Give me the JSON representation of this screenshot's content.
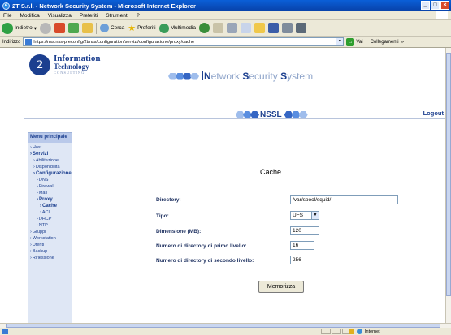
{
  "window": {
    "title": "2T S.r.l. - Network Security System - Microsoft Internet Explorer",
    "buttons": [
      "_",
      "□",
      "×"
    ]
  },
  "menubar": [
    "File",
    "Modifica",
    "Visualizza",
    "Preferiti",
    "Strumenti",
    "?"
  ],
  "toolbar": {
    "back": "Indietro",
    "search": "Cerca",
    "favorites": "Preferiti",
    "multimedia": "Multimedia"
  },
  "address": {
    "label": "Indirizzo",
    "url": "https://nss.nss-preconfig/2t/nss/configuration/servizi/configurazione/proxy/cache",
    "go": "Vai",
    "links": "Collegamenti"
  },
  "header": {
    "logo_line1": "Information",
    "logo_line2": "Technology",
    "logo_line3": "CONSULTING",
    "app_title_n": "N",
    "app_title_etwork": "etwork ",
    "app_title_s": "S",
    "app_title_ecurity": "ecurity ",
    "app_title_s2": "S",
    "app_title_ystem": "ystem",
    "logout": "Logout"
  },
  "sidebar": {
    "title": "Menu principale",
    "items": [
      {
        "label": "Host",
        "level": 1,
        "bold": false
      },
      {
        "label": "Servizi",
        "level": 1,
        "bold": true
      },
      {
        "label": "Abilitazione",
        "level": 2,
        "bold": false
      },
      {
        "label": "Disponibilità",
        "level": 2,
        "bold": false
      },
      {
        "label": "Configurazione",
        "level": 2,
        "bold": true
      },
      {
        "label": "DNS",
        "level": 3,
        "bold": false
      },
      {
        "label": "Firewall",
        "level": 3,
        "bold": false
      },
      {
        "label": "Mail",
        "level": 3,
        "bold": false
      },
      {
        "label": "Proxy",
        "level": 3,
        "bold": true
      },
      {
        "label": "Cache",
        "level": 4,
        "bold": true
      },
      {
        "label": "ACL",
        "level": 4,
        "bold": false
      },
      {
        "label": "DHCP",
        "level": 3,
        "bold": false
      },
      {
        "label": "NTP",
        "level": 3,
        "bold": false
      },
      {
        "label": "Gruppi",
        "level": 1,
        "bold": false
      },
      {
        "label": "Workstation",
        "level": 1,
        "bold": false
      },
      {
        "label": "Utenti",
        "level": 1,
        "bold": false
      },
      {
        "label": "Backup",
        "level": 1,
        "bold": false
      },
      {
        "label": "Riflessione",
        "level": 1,
        "bold": false
      }
    ]
  },
  "main": {
    "nss_mark": "NSSL",
    "page_title": "Cache",
    "fields": {
      "directory_label": "Directory:",
      "directory_value": "/var/spool/squid/",
      "tipo_label": "Tipo:",
      "tipo_value": "UFS",
      "dimensione_label": "Dimensione (MB):",
      "dimensione_value": "120",
      "primo_label": "Numero di directory di primo livello:",
      "primo_value": "16",
      "secondo_label": "Numero di directory di secondo livello:",
      "secondo_value": "256"
    },
    "save_label": "Memorizza"
  },
  "status": {
    "zone": "Internet"
  }
}
